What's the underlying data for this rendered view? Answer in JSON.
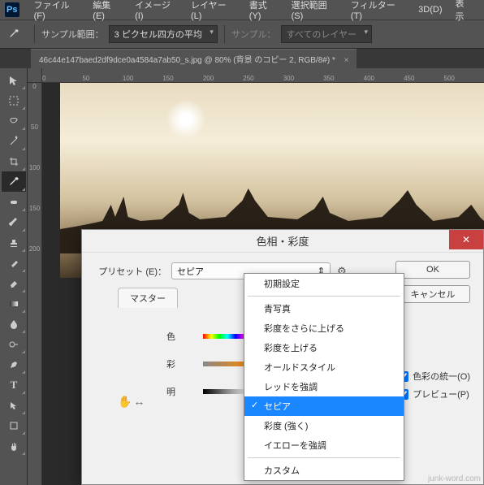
{
  "app": {
    "logo": "Ps"
  },
  "menu": {
    "file": "ファイル(F)",
    "edit": "編集(E)",
    "image": "イメージ(I)",
    "layer": "レイヤー(L)",
    "type": "書式(Y)",
    "select": "選択範囲(S)",
    "filter": "フィルター(T)",
    "3d": "3D(D)",
    "view": "表示"
  },
  "options": {
    "sample_size_label": "サンプル範囲：",
    "sample_size_value": "3 ピクセル四方の平均",
    "sample_label": "サンプル：",
    "sample_value": "すべてのレイヤー"
  },
  "doc": {
    "title": "46c44e147baed2df9dce0a4584a7ab50_s.jpg @ 80% (背景 のコピー 2, RGB/8#) *"
  },
  "ruler_h": [
    "0",
    "50",
    "100",
    "150",
    "200",
    "250",
    "300",
    "350",
    "400",
    "450",
    "500"
  ],
  "ruler_v": [
    "0",
    "50",
    "100",
    "150",
    "200"
  ],
  "dialog": {
    "title": "色相・彩度",
    "preset_label": "プリセット (E)：",
    "preset_value": "セピア",
    "ok": "OK",
    "cancel": "キャンセル",
    "master_tab": "マスター",
    "slider_hue": "色",
    "slider_sat": "彩",
    "slider_light": "明",
    "colorize": "色彩の統一(O)",
    "preview": "プレビュー(P)"
  },
  "presets": {
    "default": "初期設定",
    "cyanotype": "青写真",
    "sat_more": "彩度をさらに上げる",
    "sat_up": "彩度を上げる",
    "oldstyle": "オールドスタイル",
    "red_boost": "レッドを強調",
    "sepia": "セピア",
    "sat_strong": "彩度 (強く)",
    "yellow_boost": "イエローを強調",
    "custom": "カスタム"
  },
  "watermark": "junk-word.com"
}
